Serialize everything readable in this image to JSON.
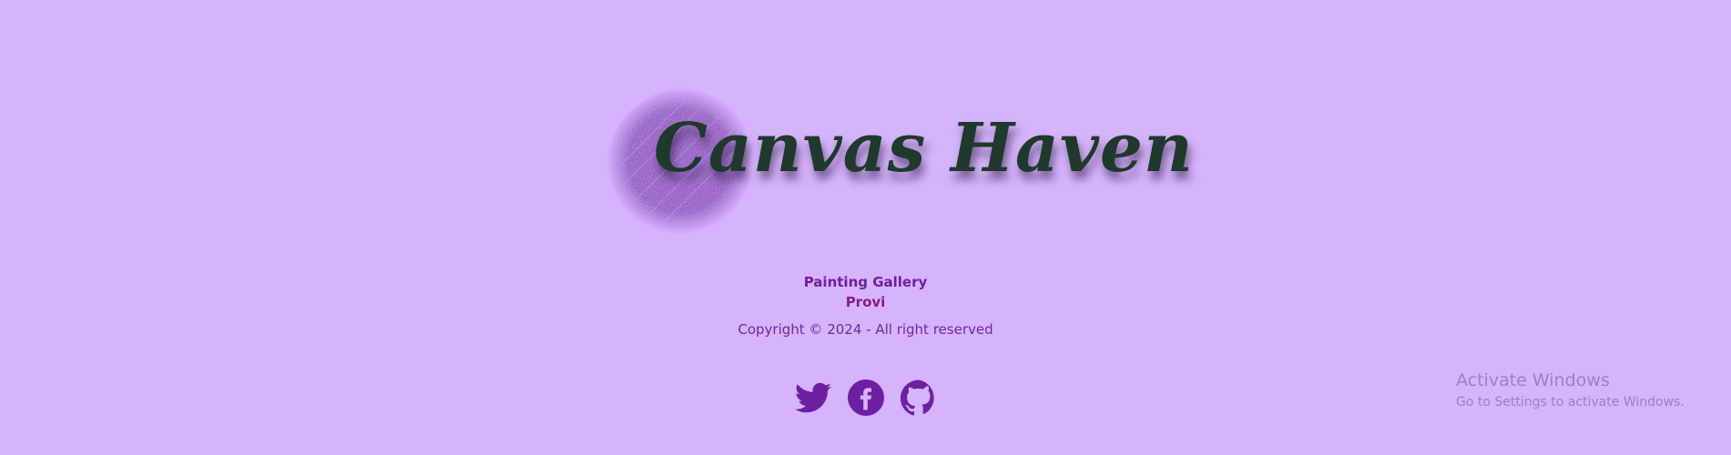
{
  "brand": {
    "name": "Canvas Haven",
    "text_color": "#1d3a2a",
    "splat_color": "#a86ae0"
  },
  "footer": {
    "tagline_line1": "Painting Gallery",
    "tagline_line2": "Provi",
    "copyright": "Copyright © 2024 - All right reserved",
    "background": "#d6b3fd",
    "accent": "#6d1fa3"
  },
  "social": [
    {
      "icon": "twitter-icon",
      "label": "Twitter"
    },
    {
      "icon": "facebook-icon",
      "label": "Facebook"
    },
    {
      "icon": "github-icon",
      "label": "GitHub"
    }
  ],
  "watermark": {
    "title": "Activate Windows",
    "subtitle": "Go to Settings to activate Windows."
  }
}
